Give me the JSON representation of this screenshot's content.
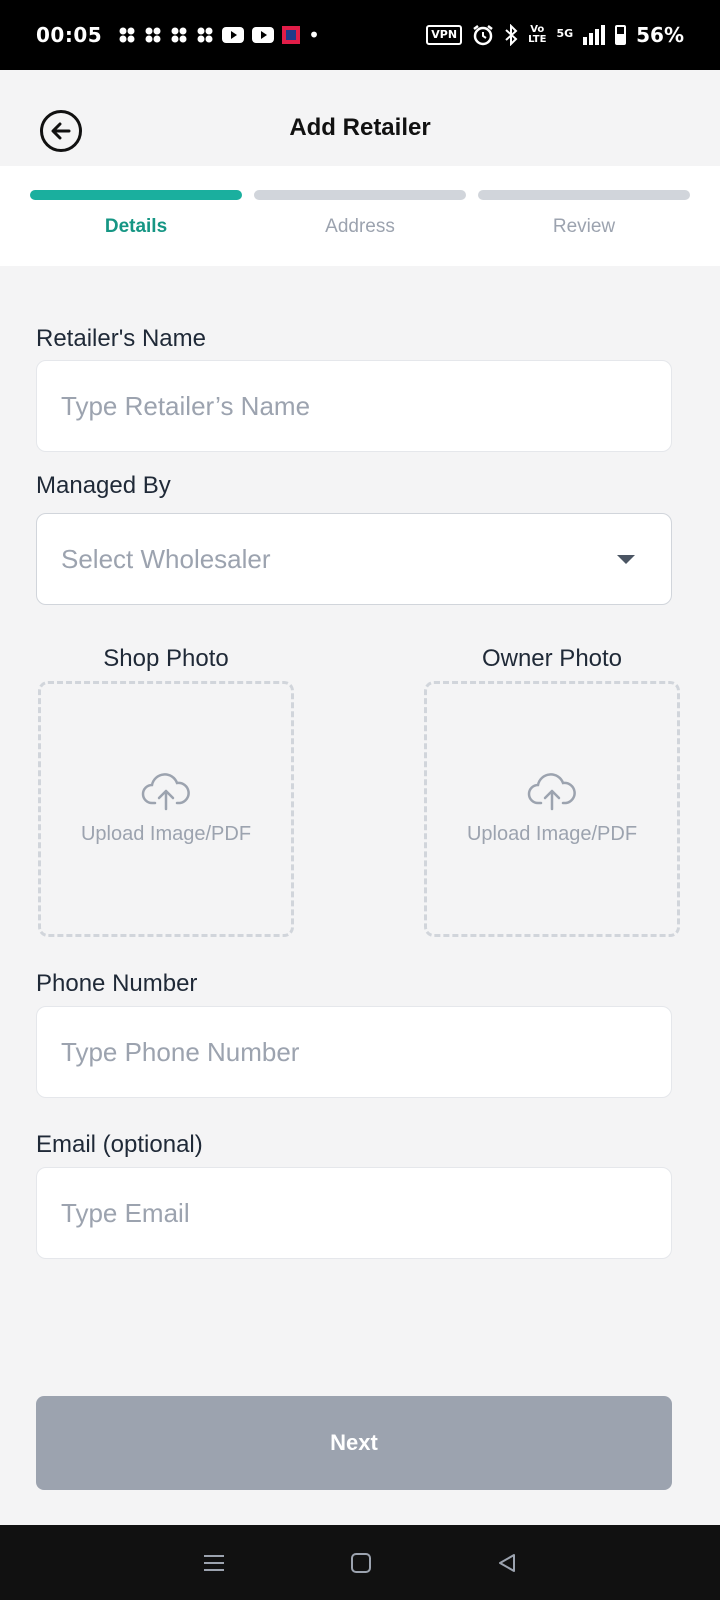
{
  "status_bar": {
    "time": "00:05",
    "battery_percent": "56%",
    "vpn": "VPN",
    "network": "5G",
    "volte": "Vo LTE",
    "battery_level": 0.56
  },
  "header": {
    "title": "Add Retailer"
  },
  "stepper": {
    "steps": [
      {
        "label": "Details",
        "active": true
      },
      {
        "label": "Address",
        "active": false
      },
      {
        "label": "Review",
        "active": false
      }
    ]
  },
  "form": {
    "retailer_name": {
      "label": "Retailer's Name",
      "placeholder": "Type Retailer’s Name",
      "value": ""
    },
    "managed_by": {
      "label": "Managed By",
      "placeholder": "Select Wholesaler"
    },
    "shop_photo": {
      "label": "Shop Photo",
      "upload_text": "Upload Image/PDF"
    },
    "owner_photo": {
      "label": "Owner Photo",
      "upload_text": "Upload Image/PDF"
    },
    "phone": {
      "label": "Phone Number",
      "placeholder": "Type Phone Number",
      "value": ""
    },
    "email": {
      "label": "Email (optional)",
      "placeholder": "Type Email",
      "value": ""
    }
  },
  "actions": {
    "next_label": "Next"
  },
  "colors": {
    "accent": "#1aaf9e",
    "inactive_step": "#d1d5db",
    "disabled_button": "#9ca3af"
  },
  "icons": {
    "back": "arrow-left-circle-icon",
    "upload": "cloud-upload-icon",
    "dropdown": "caret-down-icon",
    "nav_menu": "menu-icon",
    "nav_home": "square-home-icon",
    "nav_back": "triangle-back-icon"
  }
}
